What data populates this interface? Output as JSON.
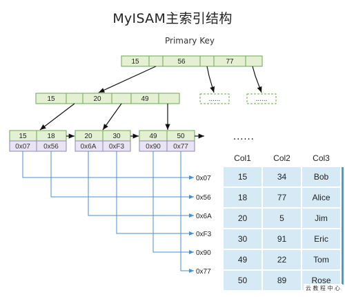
{
  "title": "MyISAM主索引结构",
  "subtitle": "Primary Key",
  "root": {
    "keys": [
      "15",
      "56",
      "77"
    ]
  },
  "level2": {
    "keys": [
      "15",
      "20",
      "49"
    ]
  },
  "leaves": [
    {
      "keys": [
        "15",
        "18"
      ],
      "addrs": [
        "0x07",
        "0x56"
      ]
    },
    {
      "keys": [
        "20",
        "30"
      ],
      "addrs": [
        "0x6A",
        "0xF3"
      ]
    },
    {
      "keys": [
        "49",
        "50"
      ],
      "addrs": [
        "0x90",
        "0x77"
      ]
    }
  ],
  "placeholder_dots": "......",
  "leaf_dots": "......",
  "addresses": [
    "0x07",
    "0x56",
    "0x6A",
    "0xF3",
    "0x90",
    "0x77"
  ],
  "table": {
    "headers": [
      "Col1",
      "Col2",
      "Col3"
    ],
    "rows": [
      [
        "15",
        "34",
        "Bob"
      ],
      [
        "18",
        "77",
        "Alice"
      ],
      [
        "20",
        "5",
        "Jim"
      ],
      [
        "30",
        "91",
        "Eric"
      ],
      [
        "49",
        "22",
        "Tom"
      ],
      [
        "50",
        "89",
        "Rose"
      ]
    ]
  },
  "watermark": "云 教 程 中 心",
  "colors": {
    "node_fill": "#e3f1d2",
    "node_border": "#6aa84f",
    "addr_fill": "#e8e4f4",
    "addr_border": "#8e86b6",
    "pointer_line": "#4a8fd1",
    "table_border": "#3fa0d6",
    "table_cell": "#d5eaf4"
  }
}
